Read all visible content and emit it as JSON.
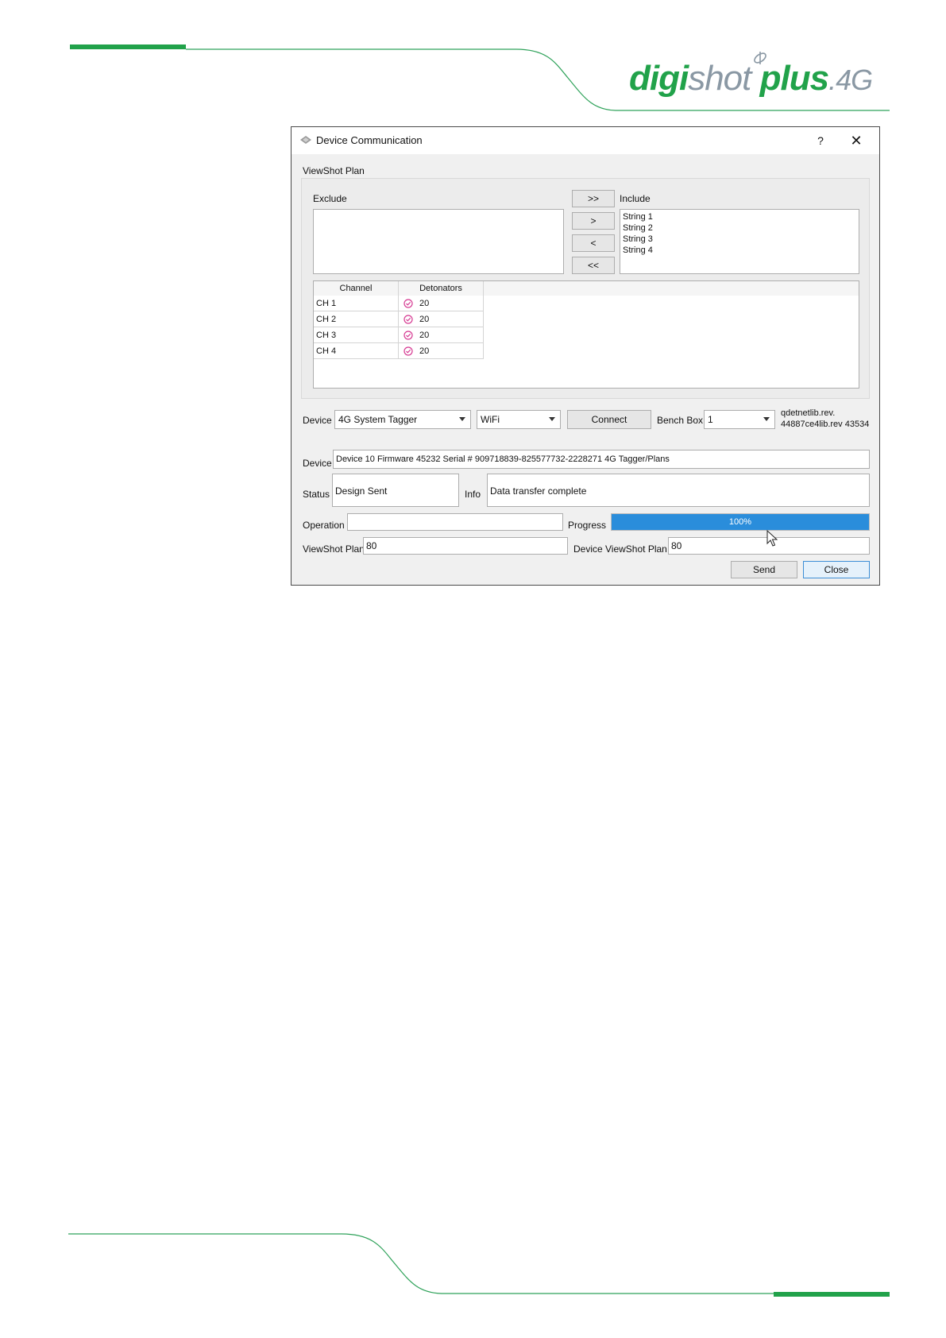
{
  "logo": {
    "part1": "digi",
    "part2": "shot",
    "part3": " plus",
    "part4": ".4G"
  },
  "colors": {
    "brand_green": "#21a24a",
    "brand_grey": "#8a98a4",
    "progress_blue": "#2a8ddb",
    "check_pink": "#d63a92"
  },
  "dialog": {
    "title": "Device Communication",
    "help_label": "?",
    "close_label": "✕",
    "section_label": "ViewShot Plan",
    "exclude_label": "Exclude",
    "include_label": "Include",
    "exclude_items": [],
    "include_items": [
      "String 1",
      "String 2",
      "String 3",
      "String 4"
    ],
    "transfer_buttons": [
      ">>",
      ">",
      "<",
      "<<"
    ],
    "table": {
      "headers": [
        "Channel",
        "Detonators"
      ],
      "rows": [
        {
          "channel": "CH 1",
          "detonators": "20",
          "status_icon": "check-circle-icon"
        },
        {
          "channel": "CH 2",
          "detonators": "20",
          "status_icon": "check-circle-icon"
        },
        {
          "channel": "CH 3",
          "detonators": "20",
          "status_icon": "check-circle-icon"
        },
        {
          "channel": "CH 4",
          "detonators": "20",
          "status_icon": "check-circle-icon"
        }
      ]
    },
    "device_label": "Device",
    "device_select": "4G System Tagger",
    "connection_select": "WiFi",
    "connect_label": "Connect",
    "bench_box_label": "Bench Box",
    "bench_box_select": "1",
    "lib_rev_line1": "qdetnetlib.rev.",
    "lib_rev_line2": "44887ce4lib.rev 43534",
    "device_info_label": "Device",
    "device_info_value": "Device 10 Firmware 45232 Serial # 909718839-825577732-2228271 4G Tagger/Plans",
    "status_label": "Status",
    "status_value": "Design Sent",
    "info_label": "Info",
    "info_value": "Data transfer complete",
    "operation_label": "Operation",
    "operation_value": "",
    "progress_label": "Progress",
    "progress_percent": 100,
    "progress_text": "100%",
    "viewshot_plan_label": "ViewShot Plan",
    "viewshot_plan_value": "80",
    "device_viewshot_plan_label": "Device ViewShot Plan",
    "device_viewshot_plan_value": "80",
    "send_label": "Send",
    "close_button_label": "Close"
  }
}
